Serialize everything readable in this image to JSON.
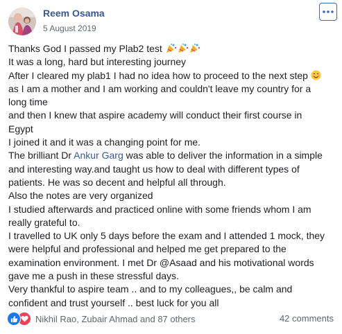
{
  "post": {
    "author": "Reem Osama",
    "date": "5 August 2019",
    "more_icon": "three-dots-icon",
    "body": {
      "line1": "Thanks God I passed my Plab2 test",
      "line2": "It was a long, hard but interesting journey",
      "line3": "After I cleared my plab1 I had no idea how to proceed to the next step",
      "line4": "as I am a mother and I am working and couldn't leave my country for a",
      "line5": "long time",
      "line6": "and then I knew that aspire academy will conduct their first course in",
      "line7": "Egypt",
      "line8": "I joined it and it was a changing point for me.",
      "line9_before": "The brilliant Dr ",
      "line9_mention": "Ankur Garg",
      "line9_after": " was able to deliver the information in a simple",
      "line10": "and interesting way.and taught us how to deal with different types of",
      "line11": "patients. He was so decent and helpful all through.",
      "line12": "Also the notes are very organized",
      "line13": "I studied afterwards and practiced online with some friends whom I am",
      "line14": "really grateful to.",
      "line15": "I travelled to UK only 5 days before the exam and I attended 1 mock, they",
      "line16": "were helpful and professional and helped me get prepared to the",
      "line17": "examination environment. I met Dr @Asaad and his motivational words",
      "line18": "gave me a push in these stressful days.",
      "line19": "Very thankful to aspire team .. and to my colleagues,, be calm and",
      "line20": "confident and trust yourself .. best luck for you all"
    },
    "emojis": [
      "party-popper-icon",
      "party-popper-icon",
      "party-popper-icon",
      "smiling-face-icon"
    ]
  },
  "footer": {
    "reaction_icons": [
      "like-icon",
      "love-icon"
    ],
    "reactions_text": "Nikhil Rao, Zubair Ahmad and 87 others",
    "comments_text": "42 comments"
  },
  "colors": {
    "link": "#385898",
    "like": "#1877f2",
    "love": "#f33e58",
    "muted": "#606770",
    "text": "#1c1e21"
  }
}
